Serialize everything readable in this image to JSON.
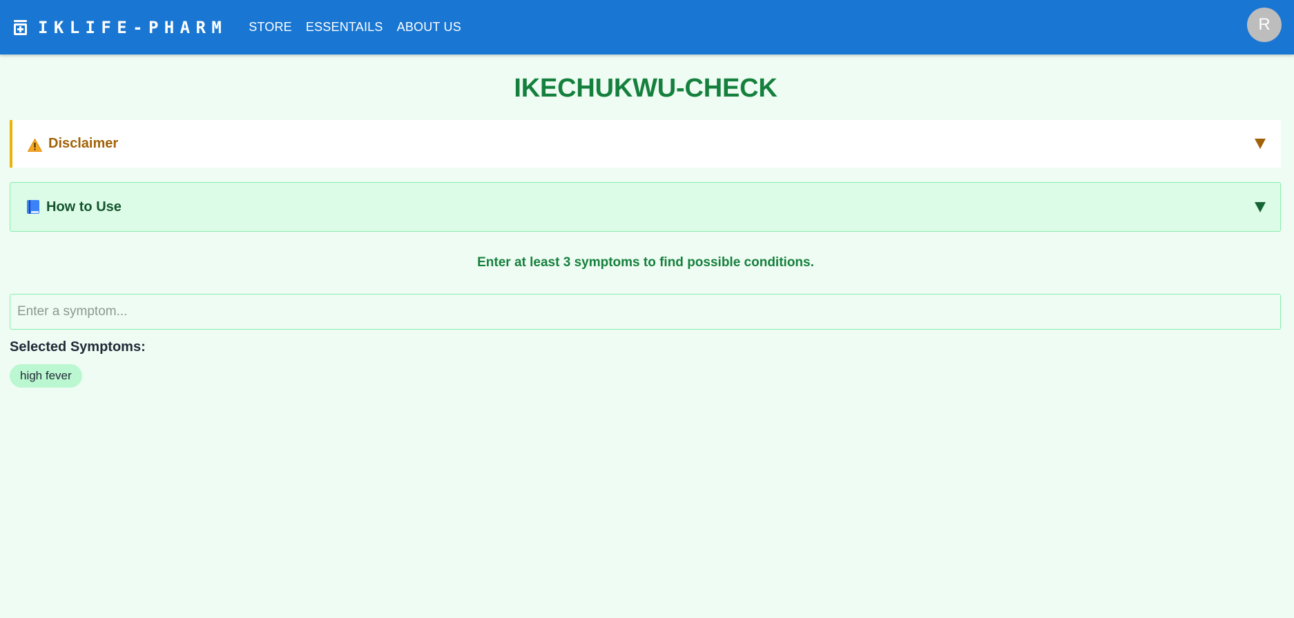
{
  "header": {
    "brand": "IKLIFE-PHARM",
    "nav": [
      {
        "label": "STORE"
      },
      {
        "label": "ESSENTAILS"
      },
      {
        "label": "ABOUT US"
      }
    ],
    "avatar_initial": "R"
  },
  "main": {
    "title": "IKECHUKWU-CHECK",
    "disclaimer_label": "Disclaimer",
    "howto_label": "How to Use",
    "instruction": "Enter at least 3 symptoms to find possible conditions.",
    "search": {
      "placeholder": "Enter a symptom...",
      "value": ""
    },
    "selected_heading": "Selected Symptoms:",
    "selected_symptoms": [
      "high fever"
    ]
  },
  "colors": {
    "appbar": "#1976d2",
    "page_bg": "#effcf3",
    "title_green": "#15803d",
    "disclaimer_accent": "#eab308",
    "disclaimer_text": "#a16207",
    "howto_bg": "#dcfce7",
    "chip_bg": "#bbf7d0"
  },
  "icons": {
    "brand": "medication-jar-icon",
    "disclaimer": "warning-icon",
    "howto": "book-icon",
    "expand": "triangle-down-icon"
  }
}
